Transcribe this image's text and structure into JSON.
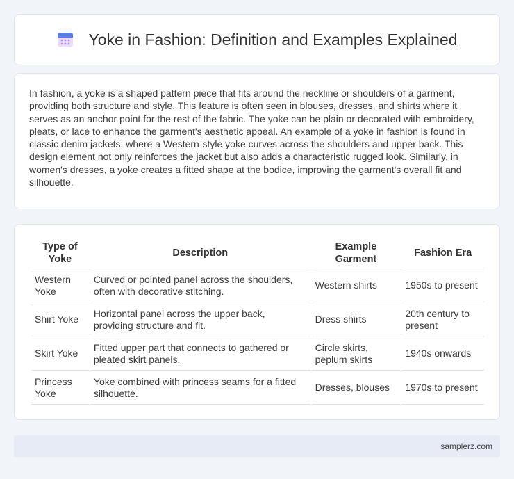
{
  "header": {
    "title": "Yoke in Fashion: Definition and Examples Explained",
    "icon": "calendar-icon"
  },
  "intro": {
    "text": "In fashion, a yoke is a shaped pattern piece that fits around the neckline or shoulders of a garment, providing both structure and style. This feature is often seen in blouses, dresses, and shirts where it serves as an anchor point for the rest of the fabric. The yoke can be plain or decorated with embroidery, pleats, or lace to enhance the garment's aesthetic appeal. An example of a yoke in fashion is found in classic denim jackets, where a Western-style yoke curves across the shoulders and upper back. This design element not only reinforces the jacket but also adds a characteristic rugged look. Similarly, in women's dresses, a yoke creates a fitted shape at the bodice, improving the garment's overall fit and silhouette."
  },
  "table": {
    "headers": [
      "Type of Yoke",
      "Description",
      "Example Garment",
      "Fashion Era"
    ],
    "rows": [
      [
        "Western Yoke",
        "Curved or pointed panel across the shoulders, often with decorative stitching.",
        "Western shirts",
        "1950s to present"
      ],
      [
        "Shirt Yoke",
        "Horizontal panel across the upper back, providing structure and fit.",
        "Dress shirts",
        "20th century to present"
      ],
      [
        "Skirt Yoke",
        "Fitted upper part that connects to gathered or pleated skirt panels.",
        "Circle skirts, peplum skirts",
        "1940s onwards"
      ],
      [
        "Princess Yoke",
        "Yoke combined with princess seams for a fitted silhouette.",
        "Dresses, blouses",
        "1970s to present"
      ]
    ]
  },
  "footer": {
    "site": "samplerz.com"
  },
  "colors": {
    "background": "#f1f4f9",
    "card": "#ffffff",
    "footer": "#e6ebf5",
    "icon_blue": "#5b7ee5",
    "icon_purple": "#b58ee8"
  }
}
